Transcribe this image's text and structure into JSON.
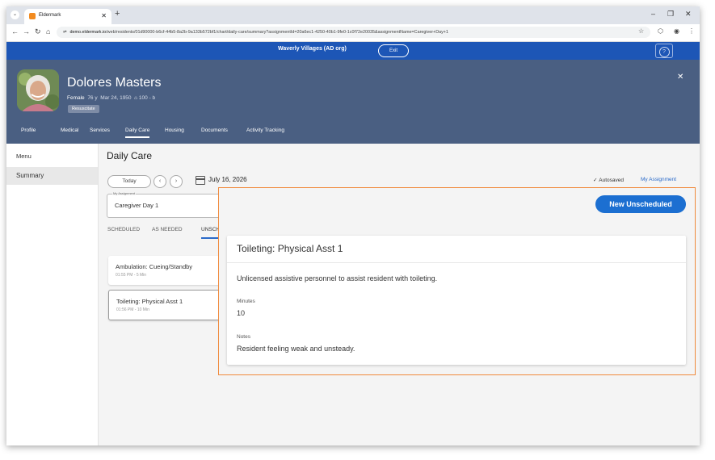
{
  "browser": {
    "tab_title": "Eldermark",
    "url_host": "demo.eldermark.io",
    "url_rest": "/web/residents/01d90000-b6cf-44b5-8a2b-9a133b572bf1/chart/daily-care/summary?assignmentId=20a6ec1-4250-40b1-9fe0-1c0f72e20035&assignmentName=Caregiver+Day+1"
  },
  "banner": {
    "org": "Waverly Villages (AD org)",
    "exit_label": "Exit",
    "help_label": "?"
  },
  "resident": {
    "name": "Dolores Masters",
    "gender": "Female",
    "age": "76 y",
    "dob": "Mar 24, 1950",
    "room": "100 - b",
    "badge": "Resuscitate",
    "tabs": [
      "Profile",
      "Medical",
      "Services",
      "Daily Care",
      "Housing",
      "Documents",
      "Activity Tracking"
    ],
    "active_tab": "Daily Care"
  },
  "leftnav": {
    "menu_label": "Menu",
    "items": [
      "Summary"
    ]
  },
  "main": {
    "title": "Daily Care",
    "today_label": "Today",
    "date": "July 16, 2026",
    "autosaved": "Autosaved",
    "my_assignment_link": "My Assignment",
    "assignment_field_label": "My Assignment",
    "assignment_value": "Caregiver Day 1",
    "subtabs": [
      "SCHEDULED",
      "AS NEEDED",
      "UNSCH"
    ],
    "cards": [
      {
        "title": "Ambulation: Cueing/Standby",
        "sub": "01:55 PM - 5 Min"
      },
      {
        "title": "Toileting: Physical Asst 1",
        "sub": "01:56 PM - 10 Min"
      }
    ]
  },
  "panel": {
    "new_button": "New Unscheduled",
    "title": "Toileting: Physical Asst 1",
    "description": "Unlicensed assistive personnel to assist resident with toileting.",
    "minutes_label": "Minutes",
    "minutes_value": "10",
    "notes_label": "Notes",
    "notes_value": "Resident feeling weak and unsteady."
  },
  "colors": {
    "banner": "#1d56b6",
    "header": "#4a5f82",
    "primary_button": "#1c6fd1",
    "highlight_border": "#f08a3c"
  }
}
